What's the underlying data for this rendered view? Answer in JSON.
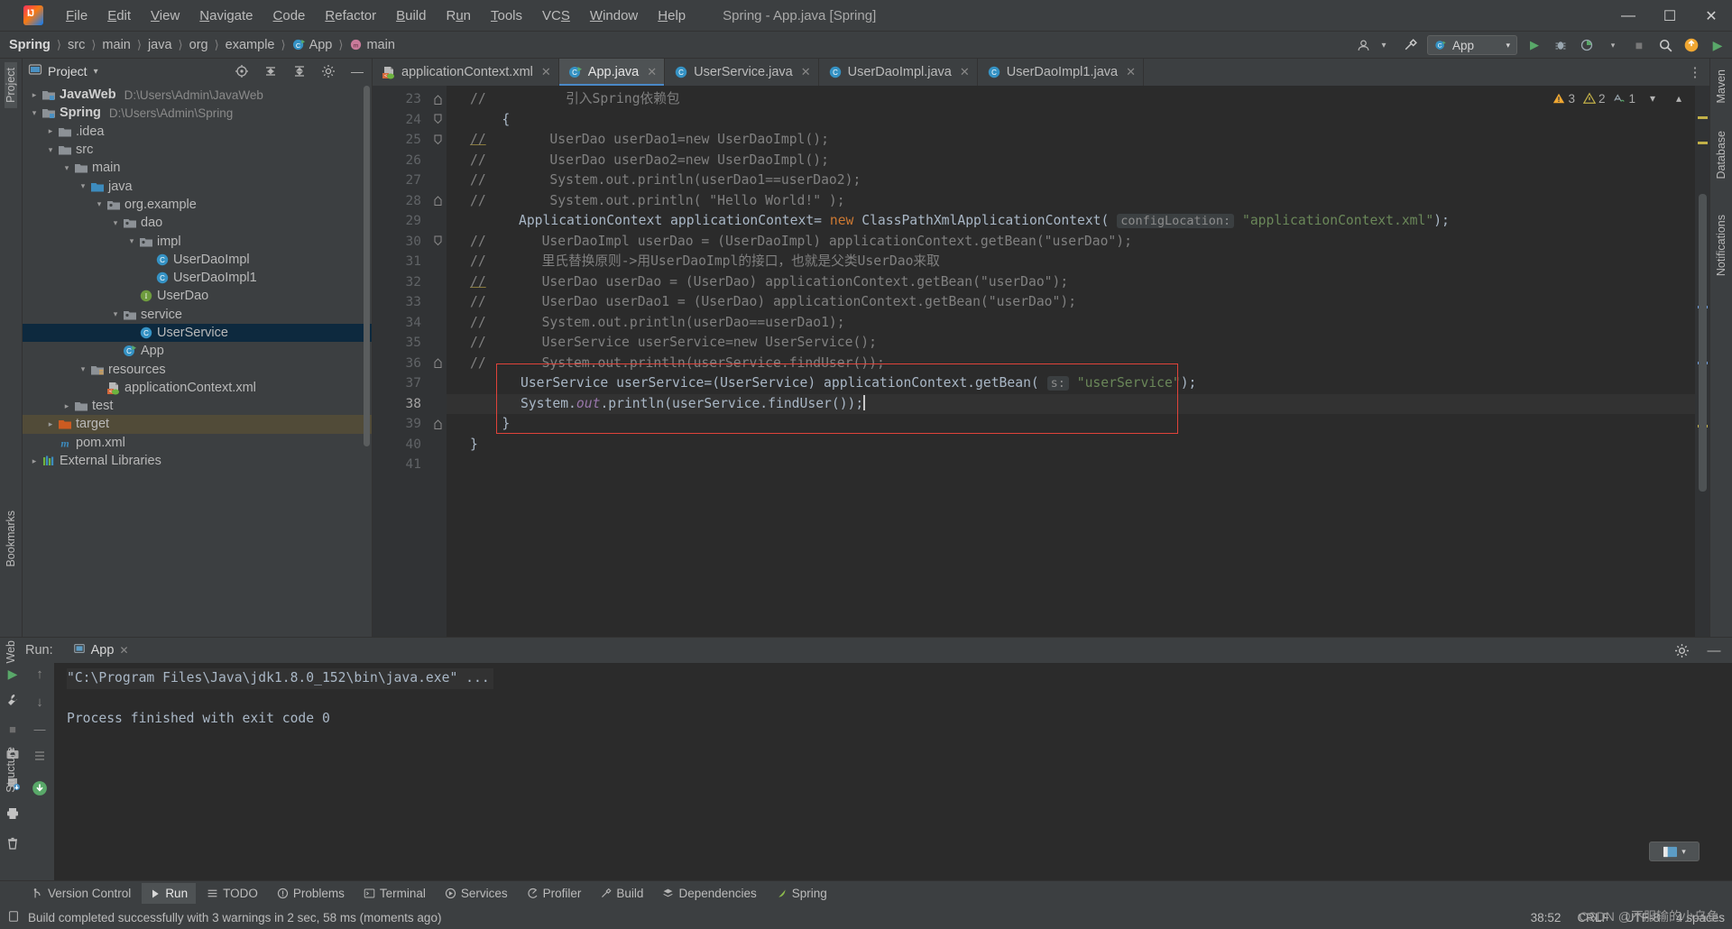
{
  "window": {
    "title": "Spring - App.java [Spring]",
    "app_icon": "intellij-idea-logo",
    "minimize": "─",
    "maximize": "❐",
    "close": "✕"
  },
  "menubar": {
    "items": [
      {
        "label": "File"
      },
      {
        "label": "Edit"
      },
      {
        "label": "View"
      },
      {
        "label": "Navigate"
      },
      {
        "label": "Code"
      },
      {
        "label": "Refactor"
      },
      {
        "label": "Build"
      },
      {
        "label": "Run"
      },
      {
        "label": "Tools"
      },
      {
        "label": "VCS"
      },
      {
        "label": "Window"
      },
      {
        "label": "Help"
      }
    ]
  },
  "breadcrumb": {
    "items": [
      "Spring",
      "src",
      "main",
      "java",
      "org",
      "example",
      "App",
      "main"
    ],
    "separator": "›"
  },
  "navbar_right": {
    "run_config": "App",
    "icons": [
      "user-avatar-icon",
      "hammer-build-icon",
      "run-icon",
      "debug-icon",
      "run-coverage-icon",
      "more-run-icon",
      "stop-icon",
      "search-icon",
      "updates-icon",
      "play-green-icon"
    ]
  },
  "project_panel": {
    "title": "Project",
    "header_icons": [
      "target-icon",
      "expand-all-icon",
      "collapse-all-icon",
      "settings-gear-icon",
      "hide-icon"
    ],
    "tree": [
      {
        "depth": 0,
        "arrow": "right",
        "icon": "module-icon",
        "label": "JavaWeb",
        "bold": true,
        "path": "D:\\Users\\Admin\\JavaWeb"
      },
      {
        "depth": 0,
        "arrow": "down",
        "icon": "module-icon",
        "label": "Spring",
        "bold": true,
        "path": "D:\\Users\\Admin\\Spring"
      },
      {
        "depth": 1,
        "arrow": "right",
        "icon": "folder-icon",
        "label": ".idea",
        "bold": false,
        "path": ""
      },
      {
        "depth": 1,
        "arrow": "down",
        "icon": "folder-icon",
        "label": "src",
        "bold": false,
        "path": ""
      },
      {
        "depth": 2,
        "arrow": "down",
        "icon": "folder-icon",
        "label": "main",
        "bold": false,
        "path": ""
      },
      {
        "depth": 3,
        "arrow": "down",
        "icon": "folder-source-icon",
        "label": "java",
        "bold": false,
        "path": ""
      },
      {
        "depth": 4,
        "arrow": "down",
        "icon": "package-icon",
        "label": "org.example",
        "bold": false,
        "path": ""
      },
      {
        "depth": 5,
        "arrow": "down",
        "icon": "package-icon",
        "label": "dao",
        "bold": false,
        "path": ""
      },
      {
        "depth": 6,
        "arrow": "down",
        "icon": "package-icon",
        "label": "impl",
        "bold": false,
        "path": ""
      },
      {
        "depth": 7,
        "arrow": "none",
        "icon": "class-icon",
        "label": "UserDaoImpl",
        "bold": false,
        "path": ""
      },
      {
        "depth": 7,
        "arrow": "none",
        "icon": "class-icon",
        "label": "UserDaoImpl1",
        "bold": false,
        "path": ""
      },
      {
        "depth": 6,
        "arrow": "none",
        "icon": "interface-icon",
        "label": "UserDao",
        "bold": false,
        "path": ""
      },
      {
        "depth": 5,
        "arrow": "down",
        "icon": "package-icon",
        "label": "service",
        "bold": false,
        "path": ""
      },
      {
        "depth": 6,
        "arrow": "none",
        "icon": "class-icon",
        "label": "UserService",
        "bold": false,
        "path": "",
        "selected": true
      },
      {
        "depth": 5,
        "arrow": "none",
        "icon": "class-run-icon",
        "label": "App",
        "bold": false,
        "path": ""
      },
      {
        "depth": 3,
        "arrow": "down",
        "icon": "folder-resource-icon",
        "label": "resources",
        "bold": false,
        "path": ""
      },
      {
        "depth": 4,
        "arrow": "none",
        "icon": "xml-spring-icon",
        "label": "applicationContext.xml",
        "bold": false,
        "path": ""
      },
      {
        "depth": 2,
        "arrow": "right",
        "icon": "folder-icon",
        "label": "test",
        "bold": false,
        "path": ""
      },
      {
        "depth": 1,
        "arrow": "right",
        "icon": "folder-target-icon",
        "label": "target",
        "bold": false,
        "path": "",
        "target": true
      },
      {
        "depth": 1,
        "arrow": "none",
        "icon": "maven-icon",
        "label": "pom.xml",
        "bold": false,
        "path": ""
      },
      {
        "depth": 0,
        "arrow": "right",
        "icon": "libraries-icon",
        "label": "External Libraries",
        "bold": false,
        "path": ""
      }
    ]
  },
  "left_strip": {
    "items": [
      "Project",
      "Bookmarks",
      "Web",
      "Structure"
    ]
  },
  "right_strip": {
    "items": [
      "Maven",
      "Database",
      "Notifications"
    ]
  },
  "editor_tabs": [
    {
      "label": "applicationContext.xml",
      "icon": "xml-spring-icon",
      "active": false
    },
    {
      "label": "App.java",
      "icon": "class-run-icon",
      "active": true
    },
    {
      "label": "UserService.java",
      "icon": "class-icon",
      "active": false
    },
    {
      "label": "UserDaoImpl.java",
      "icon": "class-icon",
      "active": false
    },
    {
      "label": "UserDaoImpl1.java",
      "icon": "class-icon",
      "active": false
    }
  ],
  "inspection_widget": {
    "warnings": "3",
    "weak_warnings": "2",
    "typos": "1",
    "warn_icon": "warning-triangle-icon",
    "weak_icon": "weak-warning-icon",
    "typo_icon": "typo-icon",
    "chevron_down": "⌄",
    "chevron_up": "⌃"
  },
  "code": {
    "first_line_number": 23,
    "lines": [
      {
        "n": 23,
        "fold": "fold-end",
        "text": "//          引入Spring依赖包",
        "type": "comment",
        "partial_top": true
      },
      {
        "n": 24,
        "fold": "fold-collapse",
        "text": "    {",
        "type": "code"
      },
      {
        "n": 25,
        "fold": "fold-collapse",
        "text": "//        UserDao userDao1=new UserDaoImpl();",
        "type": "comment-underline"
      },
      {
        "n": 26,
        "fold": "",
        "text": "//        UserDao userDao2=new UserDaoImpl();",
        "type": "comment"
      },
      {
        "n": 27,
        "fold": "",
        "text": "//        System.out.println(userDao1==userDao2);",
        "type": "comment"
      },
      {
        "n": 28,
        "fold": "fold-end",
        "text": "//        System.out.println( \"Hello World!\" );",
        "type": "comment"
      },
      {
        "n": 29,
        "fold": "",
        "text": "ApplicationContext applicationContext= new ClassPathXmlApplicationContext( configLocation: \"applicationContext.xml\");",
        "type": "code-line29"
      },
      {
        "n": 30,
        "fold": "fold-collapse",
        "text": "//       UserDaoImpl userDao = (UserDaoImpl) applicationContext.getBean(\"userDao\");",
        "type": "comment"
      },
      {
        "n": 31,
        "fold": "",
        "text": "//       里氏替换原则->用UserDaoImpl的接口，也就是父类UserDao来取",
        "type": "comment"
      },
      {
        "n": 32,
        "fold": "",
        "text": "//       UserDao userDao = (UserDao) applicationContext.getBean(\"userDao\");",
        "type": "comment-underline"
      },
      {
        "n": 33,
        "fold": "",
        "text": "//       UserDao userDao1 = (UserDao) applicationContext.getBean(\"userDao\");",
        "type": "comment"
      },
      {
        "n": 34,
        "fold": "",
        "text": "//       System.out.println(userDao==userDao1);",
        "type": "comment"
      },
      {
        "n": 35,
        "fold": "",
        "text": "//       UserService userService=new UserService();",
        "type": "comment"
      },
      {
        "n": 36,
        "fold": "fold-end",
        "text": "//       System.out.println(userService.findUser());",
        "type": "comment"
      },
      {
        "n": 37,
        "fold": "",
        "text": "UserService userService=(UserService) applicationContext.getBean( s: \"userService\");",
        "type": "code-line37"
      },
      {
        "n": 38,
        "fold": "",
        "text": "System.out.println(userService.findUser());",
        "type": "code-line38",
        "current": true
      },
      {
        "n": 39,
        "fold": "fold-end",
        "text": "    }",
        "type": "code"
      },
      {
        "n": 40,
        "fold": "",
        "text": "}",
        "type": "code"
      },
      {
        "n": 41,
        "fold": "",
        "text": "",
        "type": "code"
      }
    ],
    "hint_config_location": "configLocation:",
    "hint_s": "s:"
  },
  "run_window": {
    "label": "Run:",
    "tab": "App",
    "tab_icon": "console-icon",
    "close_icon": "✕",
    "settings_icon": "settings-gear-icon",
    "hide_icon": "─",
    "console_lines": [
      "\"C:\\Program Files\\Java\\jdk1.8.0_152\\bin\\java.exe\" ...",
      "",
      "Process finished with exit code 0"
    ],
    "gutter_icons": [
      "rerun-icon",
      "settings-wrench-icon",
      "stop-icon",
      "camera-icon",
      "export-icon",
      "print-icon",
      "trash-icon"
    ],
    "nav_icons": [
      "scroll-up-icon",
      "scroll-down-icon"
    ]
  },
  "bottom_bar": {
    "items": [
      {
        "label": "Version Control",
        "icon": "branch-icon",
        "selected": false
      },
      {
        "label": "Run",
        "icon": "play-icon",
        "selected": true
      },
      {
        "label": "TODO",
        "icon": "todo-icon",
        "selected": false
      },
      {
        "label": "Problems",
        "icon": "problems-icon",
        "selected": false
      },
      {
        "label": "Terminal",
        "icon": "terminal-icon",
        "selected": false
      },
      {
        "label": "Services",
        "icon": "services-icon",
        "selected": false
      },
      {
        "label": "Profiler",
        "icon": "profiler-icon",
        "selected": false
      },
      {
        "label": "Build",
        "icon": "build-hammer-icon",
        "selected": false
      },
      {
        "label": "Dependencies",
        "icon": "dependencies-icon",
        "selected": false
      },
      {
        "label": "Spring",
        "icon": "spring-leaf-icon",
        "selected": false
      }
    ]
  },
  "status_bar": {
    "icon": "status-doc-icon",
    "message": "Build completed successfully with 3 warnings in 2 sec, 58 ms (moments ago)",
    "caret_position": "38:52",
    "line_separator": "CRLF",
    "encoding": "UTF-8",
    "indent": "4 spaces"
  },
  "watermark": "CSDN @不服输的小乌鱼",
  "colors": {
    "bg_panel": "#3c3f41",
    "bg_editor": "#2b2b2b",
    "gutter": "#313335",
    "accent_blue": "#4a88c7",
    "selection": "#0d293e",
    "target_row": "#514b38",
    "red_box": "#e0433a",
    "keyword_orange": "#cc7832",
    "string_green": "#6a8759",
    "field_purple": "#9876aa",
    "comment_gray": "#808080",
    "code_fg": "#a9b7c6"
  }
}
